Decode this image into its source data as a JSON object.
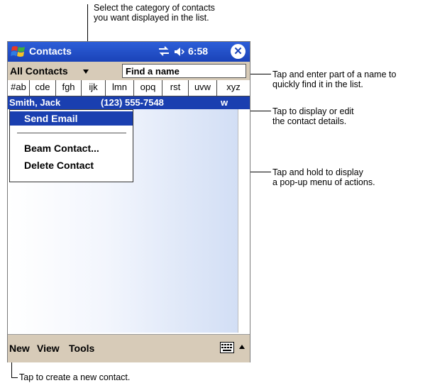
{
  "callouts": {
    "category": [
      "Select the category of contacts",
      "you want displayed in the list."
    ],
    "find": [
      "Tap and enter part of a name to",
      "quickly find it in the list."
    ],
    "details": [
      "Tap to display or edit",
      "the contact details."
    ],
    "hold": [
      "Tap and hold to display",
      "a pop-up menu of actions."
    ],
    "new": "Tap to create a new contact."
  },
  "titlebar": {
    "title": "Contacts",
    "time": "6:58",
    "start_icon": "windows-flag-icon",
    "sync_icon": "sync-icon",
    "volume_icon": "volume-icon",
    "close_icon": "close-icon"
  },
  "filter": {
    "category": "All Contacts",
    "find_placeholder": "Find a name"
  },
  "alpha_tabs": [
    "#ab",
    "cde",
    "fgh",
    "ijk",
    "lmn",
    "opq",
    "rst",
    "uvw",
    "xyz"
  ],
  "contact": {
    "name": "Smith, Jack",
    "phone": "(123) 555-7548",
    "type": "w"
  },
  "popup_menu": {
    "send_email": "Send Email",
    "beam_contact": "Beam Contact...",
    "delete_contact": "Delete Contact"
  },
  "bottom_menu": {
    "new": "New",
    "view": "View",
    "tools": "Tools",
    "keyboard_icon": "keyboard-icon"
  },
  "colors": {
    "titlebar": "#1a43b8",
    "bars": "#d7cbb8",
    "selection": "#1a3fb0"
  }
}
